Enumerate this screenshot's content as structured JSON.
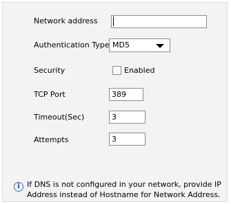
{
  "form": {
    "network_address": {
      "label": "Network address",
      "value": ""
    },
    "authentication_type": {
      "label": "Authentication Type",
      "selected": "MD5"
    },
    "security": {
      "label": "Security",
      "checkbox_label": "Enabled",
      "checked": false
    },
    "tcp_port": {
      "label": "TCP Port",
      "value": "389"
    },
    "timeout": {
      "label": "Timeout(Sec)",
      "value": "3"
    },
    "attempts": {
      "label": "Attempts",
      "value": "3"
    }
  },
  "info": {
    "icon": "info-icon",
    "icon_glyph": "i",
    "text": "If DNS is not configured in your network, provide IP Address instead of Hostname for Network Address."
  },
  "colors": {
    "panel_background": "#f3f3f3",
    "field_border": "#8c8c8c",
    "info_icon": "#4a6fa5"
  }
}
